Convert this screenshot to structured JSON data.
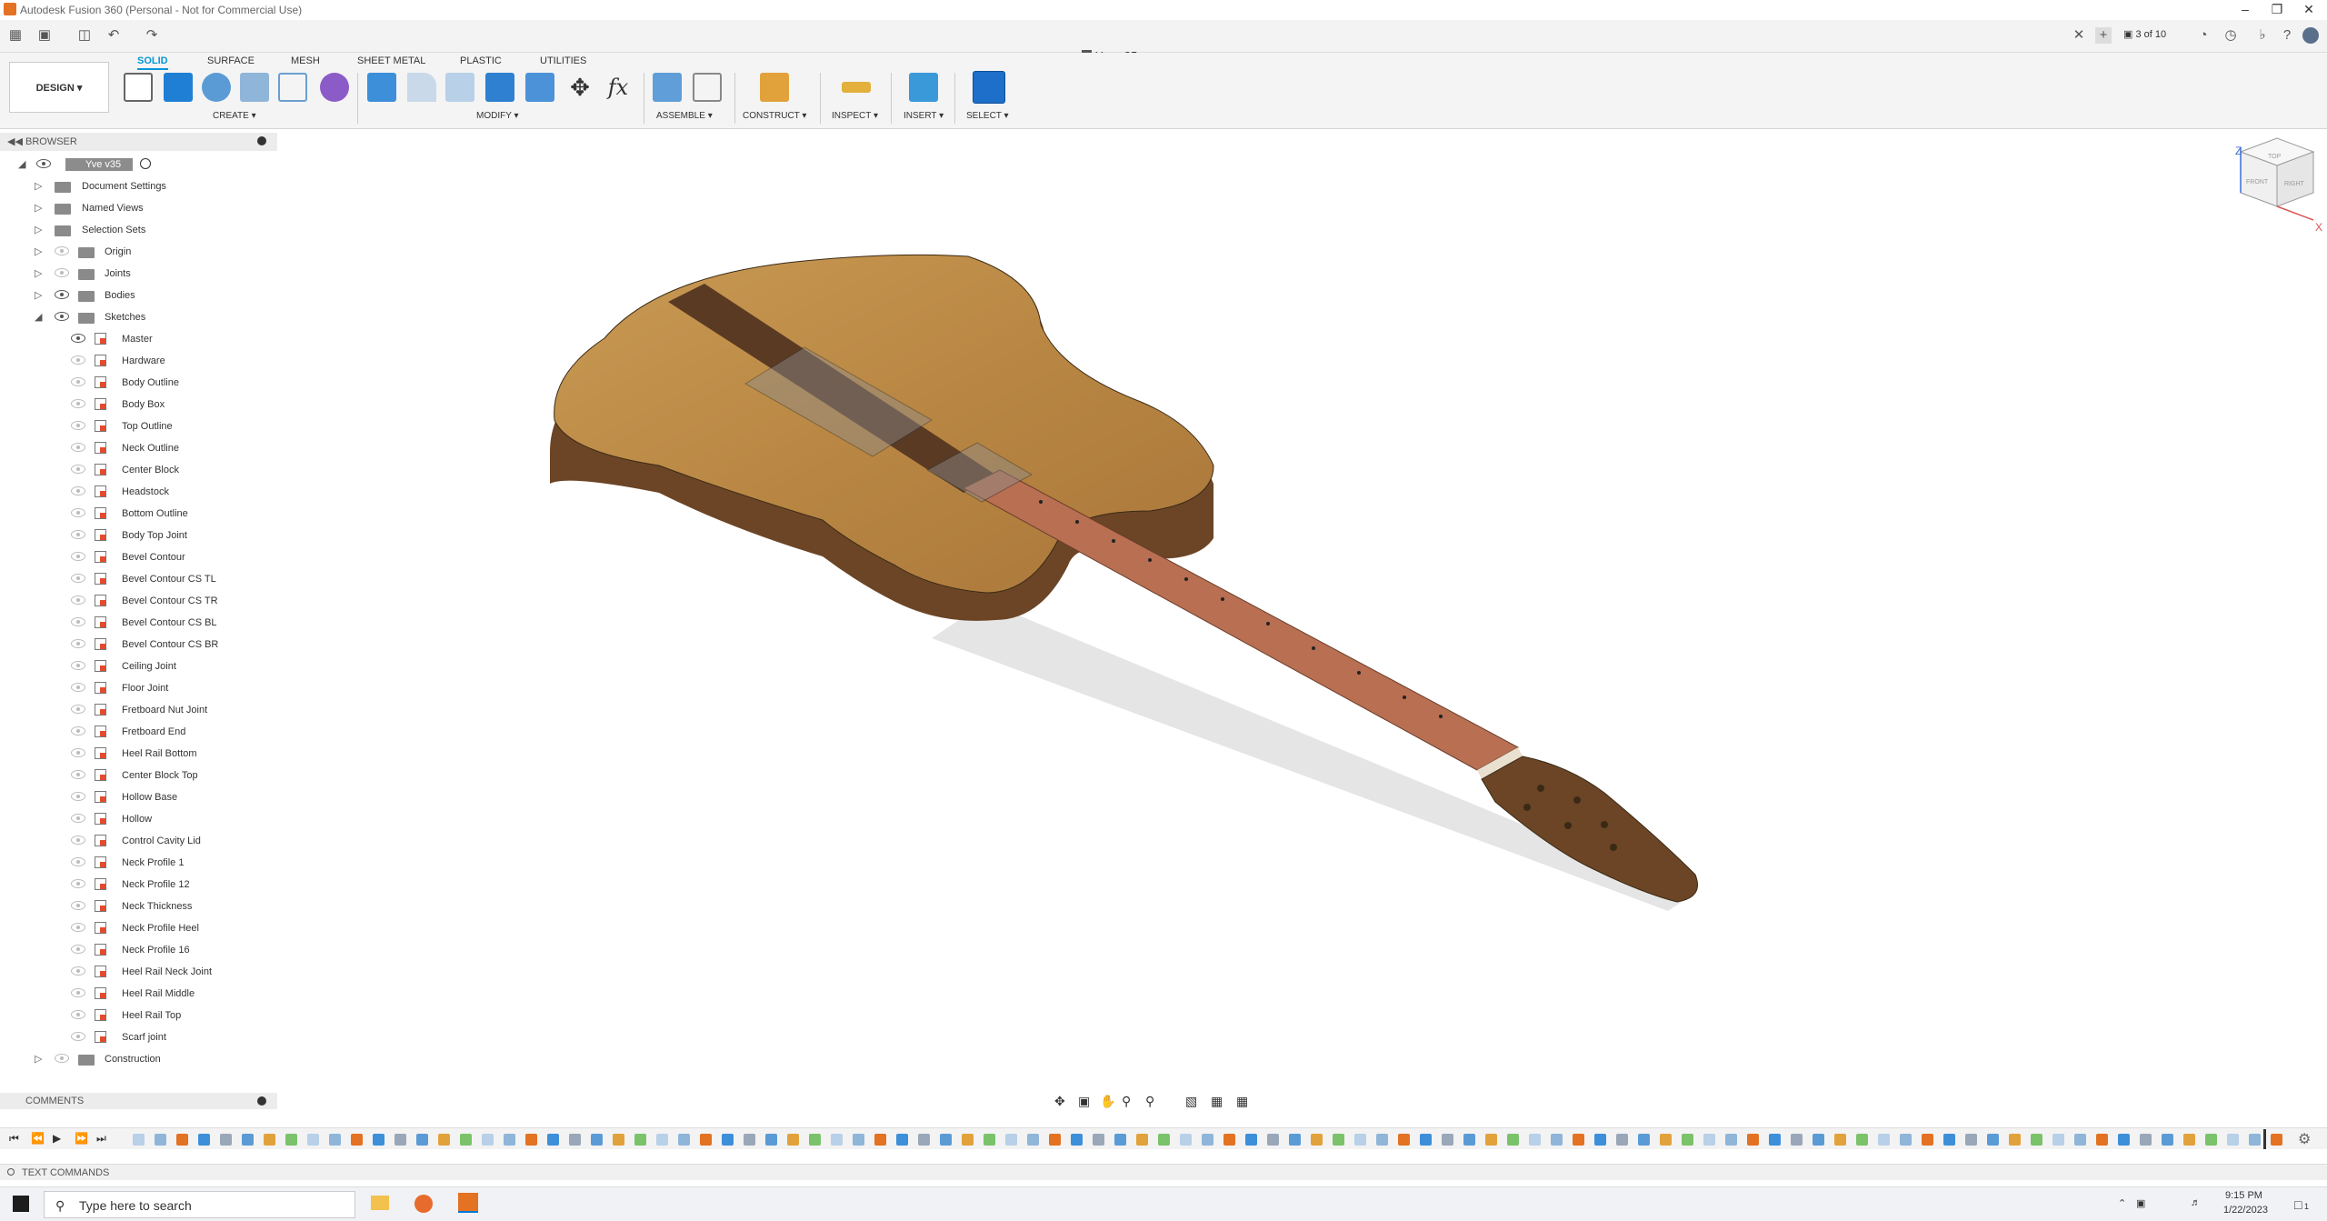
{
  "window": {
    "title": "Autodesk Fusion 360 (Personal - Not for Commercial Use)"
  },
  "quick_access": {
    "doc_title": "Yve v35",
    "version_counter": "3 of 10"
  },
  "ribbon": {
    "workspace": "DESIGN",
    "tabs": [
      "SOLID",
      "SURFACE",
      "MESH",
      "SHEET METAL",
      "PLASTIC",
      "UTILITIES"
    ],
    "active_tab": "SOLID",
    "groups": [
      "CREATE",
      "MODIFY",
      "ASSEMBLE",
      "CONSTRUCT",
      "INSPECT",
      "INSERT",
      "SELECT"
    ]
  },
  "browser": {
    "header": "BROWSER",
    "root": "Yve v35",
    "top_items": [
      "Document Settings",
      "Named Views",
      "Selection Sets"
    ],
    "folders": [
      "Origin",
      "Joints",
      "Bodies",
      "Sketches"
    ],
    "sketches": [
      "Master",
      "Hardware",
      "Body Outline",
      "Body Box",
      "Top Outline",
      "Neck Outline",
      "Center Block",
      "Headstock",
      "Bottom Outline",
      "Body Top Joint",
      "Bevel Contour",
      "Bevel Contour CS TL",
      "Bevel Contour CS TR",
      "Bevel Contour CS BL",
      "Bevel Contour CS BR",
      "Ceiling Joint",
      "Floor Joint",
      "Fretboard Nut Joint",
      "Fretboard End",
      "Heel Rail Bottom",
      "Center Block Top",
      "Hollow Base",
      "Hollow",
      "Control Cavity Lid",
      "Neck Profile 1",
      "Neck Profile 12",
      "Neck Thickness",
      "Neck Profile Heel",
      "Neck Profile 16",
      "Heel Rail Neck Joint",
      "Heel Rail Middle",
      "Heel Rail Top",
      "Scarf joint"
    ],
    "last_folder": "Construction"
  },
  "panels": {
    "comments": "COMMENTS",
    "text_commands": "TEXT COMMANDS"
  },
  "viewcube": {
    "top_label": "TOP",
    "front_label": "FRONT",
    "right_label": "RIGHT",
    "axis_z": "Z",
    "axis_x": "X"
  },
  "taskbar": {
    "search_placeholder": "Type here to search",
    "time": "9:15 PM",
    "date": "1/22/2023",
    "notification_count": "1"
  },
  "colors": {
    "accent": "#0696d7",
    "wood_light": "#c79a52",
    "wood_dark": "#6b4526",
    "fretboard": "#b86f52"
  }
}
